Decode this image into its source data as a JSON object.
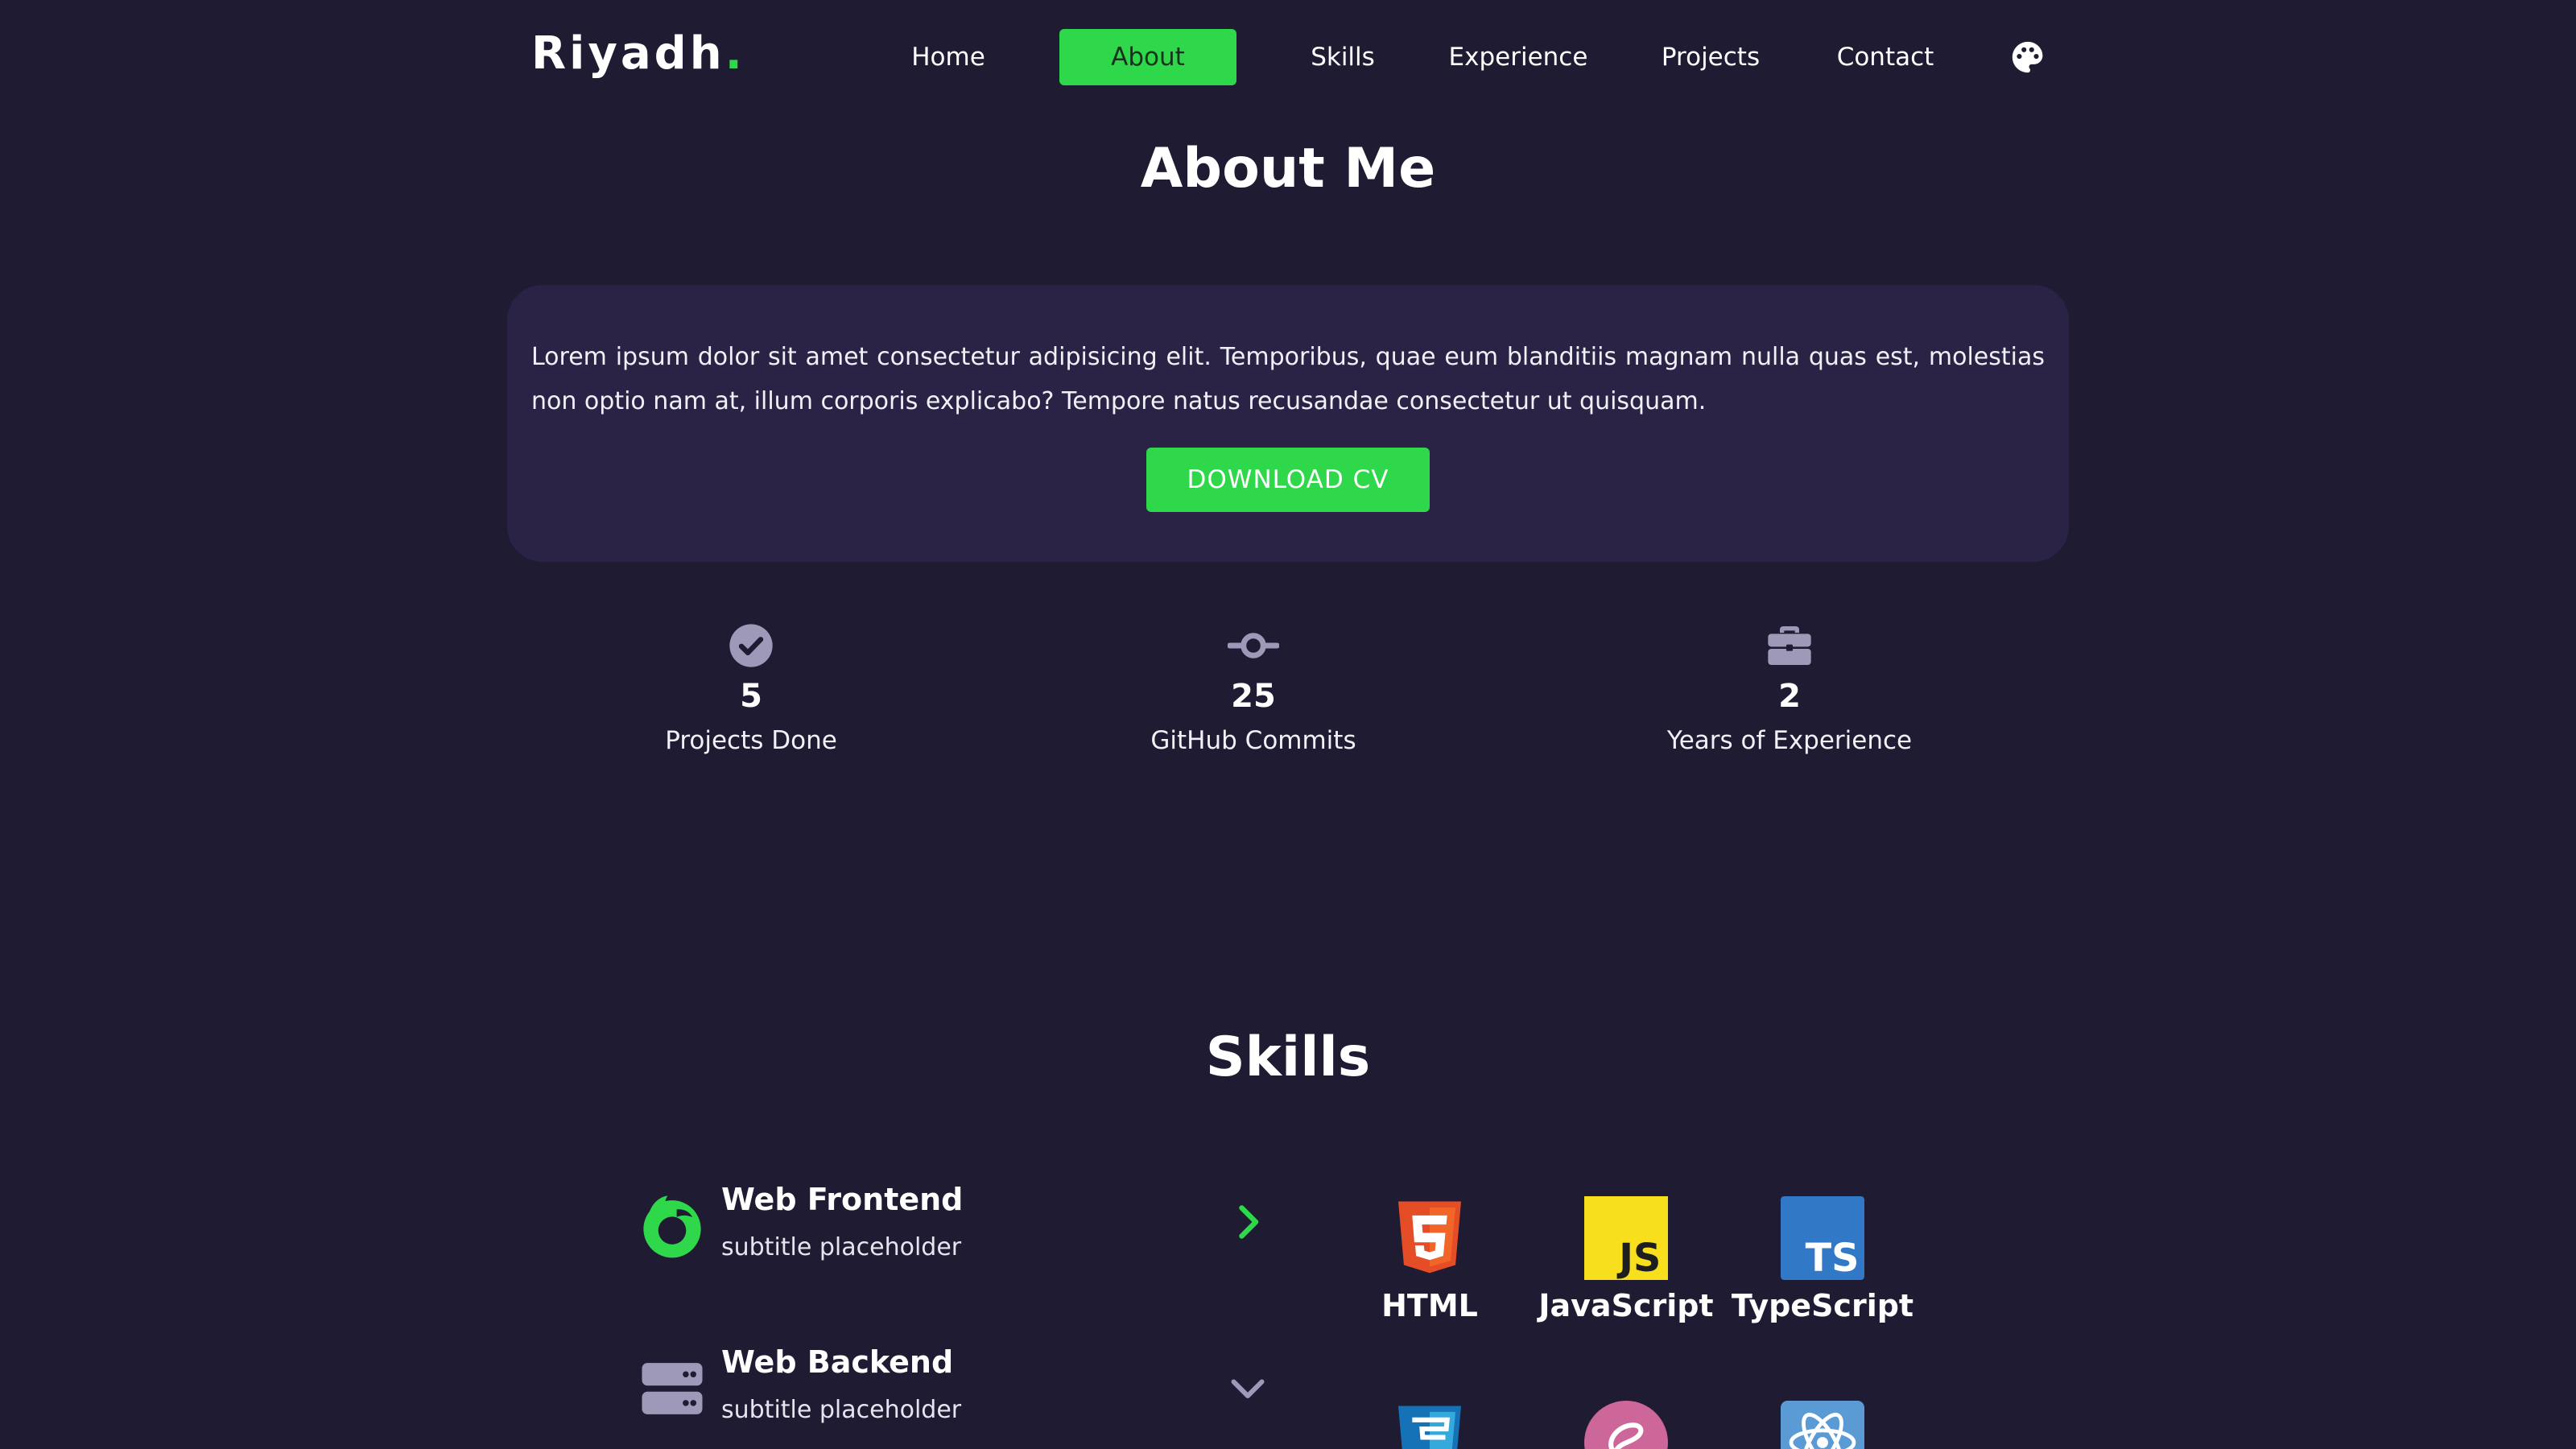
{
  "nav": {
    "logo": "Riyadh",
    "logo_dot": ".",
    "links": [
      "Home",
      "About",
      "Skills",
      "Experience",
      "Projects",
      "Contact"
    ],
    "active": "About",
    "theme_icon": "palette-icon"
  },
  "about": {
    "title": "About Me",
    "text": "Lorem ipsum dolor sit amet consectetur adipisicing elit. Temporibus, quae eum blanditiis magnam nulla quas est, molestias non optio nam at, illum corporis explicabo? Tempore natus recusandae consectetur ut quisquam.",
    "cv_button": "DOWNLOAD CV"
  },
  "stats": [
    {
      "icon": "check-circle-icon",
      "value": "5",
      "label": "Projects Done"
    },
    {
      "icon": "git-commit-icon",
      "value": "25",
      "label": "GitHub Commits"
    },
    {
      "icon": "briefcase-icon",
      "value": "2",
      "label": "Years of Experience"
    }
  ],
  "skills": {
    "title": "Skills",
    "categories": [
      {
        "icon": "firefox-icon",
        "title": "Web Frontend",
        "subtitle": "subtitle placeholder",
        "state": "expanded-right"
      },
      {
        "icon": "server-icon",
        "title": "Web Backend",
        "subtitle": "subtitle placeholder",
        "state": "collapsed"
      }
    ],
    "tech": [
      {
        "icon": "html5-icon",
        "name": "HTML"
      },
      {
        "icon": "javascript-icon",
        "name": "JavaScript"
      },
      {
        "icon": "typescript-icon",
        "name": "TypeScript"
      },
      {
        "icon": "css3-icon",
        "name": ""
      },
      {
        "icon": "sass-icon",
        "name": ""
      },
      {
        "icon": "react-icon",
        "name": ""
      }
    ]
  },
  "colors": {
    "background": "#1f1b33",
    "card": "#2a2346",
    "accent": "#2ed84a",
    "icon_muted": "#9e99b8"
  }
}
